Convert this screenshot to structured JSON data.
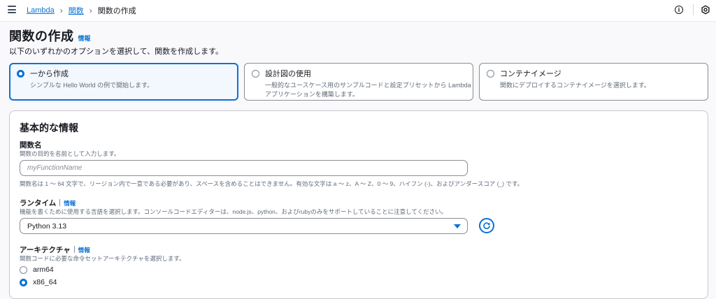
{
  "breadcrumb": {
    "items": [
      "Lambda",
      "関数",
      "関数の作成"
    ]
  },
  "header": {
    "title": "関数の作成",
    "info": "情報",
    "subtitle": "以下のいずれかのオプションを選択して、関数を作成します。"
  },
  "options": [
    {
      "title": "一から作成",
      "desc": "シンプルな Hello World の例で開始します。",
      "selected": true
    },
    {
      "title": "設計図の使用",
      "desc": "一般的なユースケース用のサンプルコードと設定プリセットから Lambda アプリケーションを構築します。",
      "selected": false
    },
    {
      "title": "コンテナイメージ",
      "desc": "関数にデプロイするコンテナイメージを選択します。",
      "selected": false
    }
  ],
  "basic": {
    "title": "基本的な情報",
    "function_name": {
      "label": "関数名",
      "hint": "関数の目的を名前として入力します。",
      "placeholder": "myFunctionName",
      "constraint": "関数名は 1 ～ 64 文字で、リージョン内で一意である必要があり、スペースを含めることはできません。有効な文字は a ～ z、A ～ Z、0 ～ 9、ハイフン (-)、およびアンダースコア (_) です。"
    },
    "runtime": {
      "label": "ランタイム",
      "info": "情報",
      "hint": "機能を書くために使用する言語を選択します。コンソールコードエディターは、node.js、python、およびrubyのみをサポートしていることに注意してください。",
      "value": "Python 3.13"
    },
    "architecture": {
      "label": "アーキテクチャ",
      "info": "情報",
      "hint": "関数コードに必要な命令セットアーキテクチャを選択します。",
      "options": [
        "arm64",
        "x86_64"
      ],
      "selected": "x86_64"
    }
  },
  "colors": {
    "accent": "#0972d3",
    "selected_bg": "#f2f8fd",
    "text": "#16191f",
    "muted": "#5f6b7a"
  }
}
